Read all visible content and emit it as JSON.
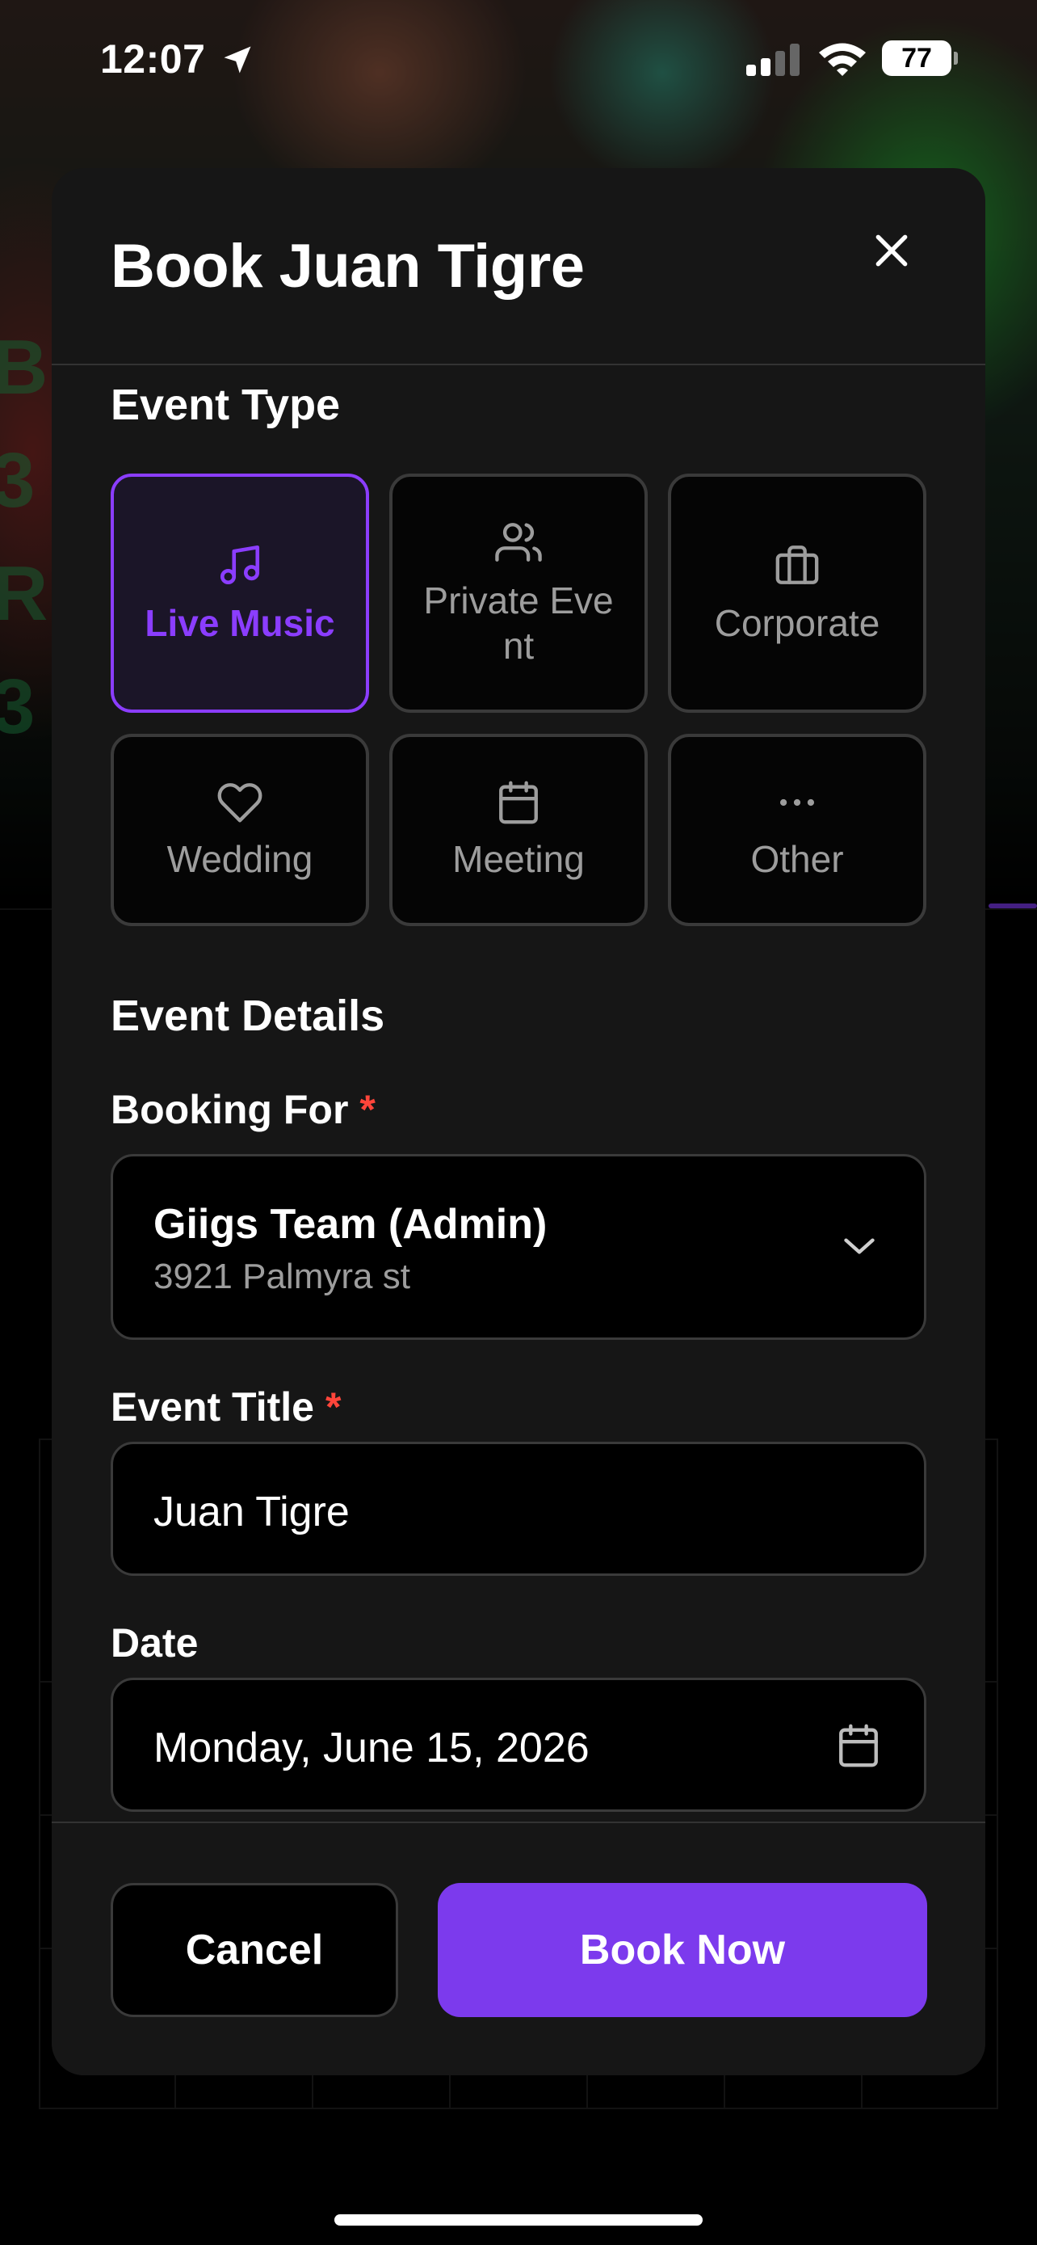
{
  "status_bar": {
    "time": "12:07",
    "battery": "77",
    "icons": [
      "location-arrow-icon",
      "cellular-signal-icon",
      "wifi-icon",
      "battery-icon"
    ]
  },
  "background": {
    "side_letters": [
      "B",
      "3",
      "R",
      "3"
    ]
  },
  "modal": {
    "title": "Book Juan Tigre",
    "close_icon": "close-icon",
    "event_type_section": {
      "title": "Event Type",
      "options": [
        {
          "label": "Live Music",
          "icon": "music-note-icon",
          "selected": true
        },
        {
          "label": "Private Event",
          "icon": "users-icon",
          "selected": false
        },
        {
          "label": "Corporate",
          "icon": "briefcase-icon",
          "selected": false
        },
        {
          "label": "Wedding",
          "icon": "heart-icon",
          "selected": false
        },
        {
          "label": "Meeting",
          "icon": "calendar-icon",
          "selected": false
        },
        {
          "label": "Other",
          "icon": "more-horizontal-icon",
          "selected": false
        }
      ]
    },
    "event_details_section": {
      "title": "Event Details",
      "booking_for": {
        "label": "Booking For",
        "required_mark": "*",
        "value": "Giigs Team (Admin)",
        "subvalue": "3921 Palmyra st"
      },
      "event_title": {
        "label": "Event Title",
        "required_mark": "*",
        "value": "Juan Tigre"
      },
      "date": {
        "label": "Date",
        "value": "Monday, June 15, 2026"
      }
    },
    "footer": {
      "cancel_label": "Cancel",
      "book_label": "Book Now"
    }
  },
  "colors": {
    "accent": "#7c3aed",
    "selected_border": "#8b3dff",
    "required": "#ff453a",
    "modal_bg": "#161616"
  }
}
